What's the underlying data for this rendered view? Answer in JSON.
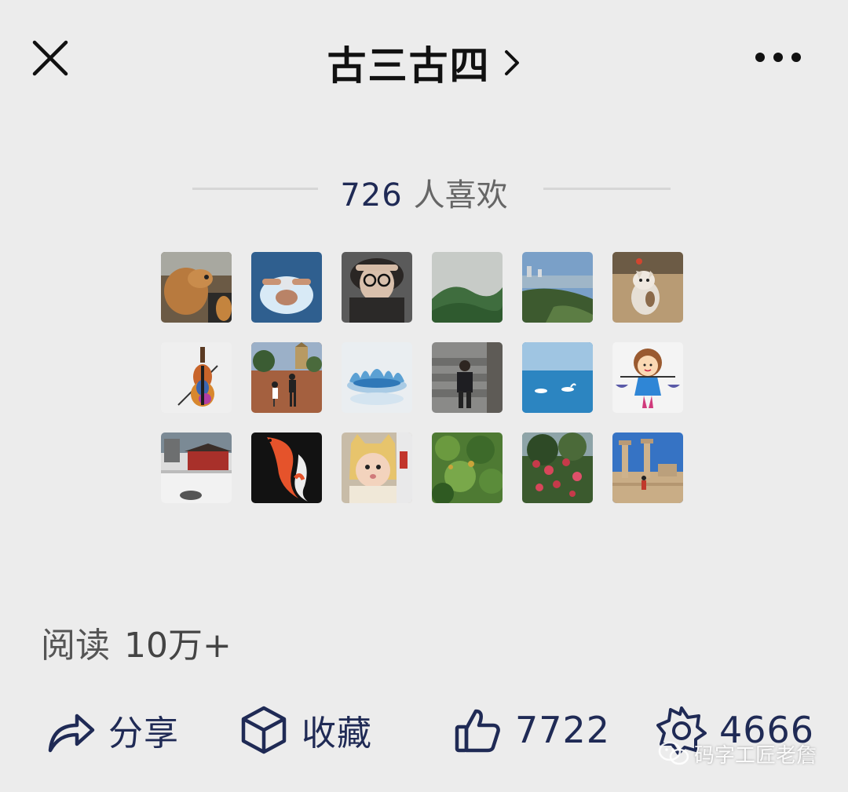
{
  "header": {
    "title": "古三古四",
    "close_icon": "close-icon",
    "chevron_icon": "chevron-right-icon",
    "more_icon": "more-dots-icon"
  },
  "likes": {
    "count": "726",
    "label": "人喜欢"
  },
  "avatars": [
    {
      "name": "dog"
    },
    {
      "name": "swimmer"
    },
    {
      "name": "woman-glasses"
    },
    {
      "name": "green-hills"
    },
    {
      "name": "river-city"
    },
    {
      "name": "cat"
    },
    {
      "name": "violin"
    },
    {
      "name": "street-walkers"
    },
    {
      "name": "water-splash"
    },
    {
      "name": "man-on-stairs"
    },
    {
      "name": "sea-swans"
    },
    {
      "name": "cartoon-girl-scale"
    },
    {
      "name": "snowy-palace"
    },
    {
      "name": "koi-fish"
    },
    {
      "name": "baby-hat"
    },
    {
      "name": "green-plants"
    },
    {
      "name": "red-flowers"
    },
    {
      "name": "ruins-columns"
    }
  ],
  "reads": {
    "label": "阅读",
    "value": "10万+"
  },
  "toolbar": {
    "share_label": "分享",
    "favorite_label": "收藏",
    "like_count": "7722",
    "wow_count": "4666"
  },
  "watermark": {
    "text": "码字工匠老詹"
  },
  "colors": {
    "background": "#ececec",
    "accent": "#1f2a55",
    "muted": "#666666"
  }
}
